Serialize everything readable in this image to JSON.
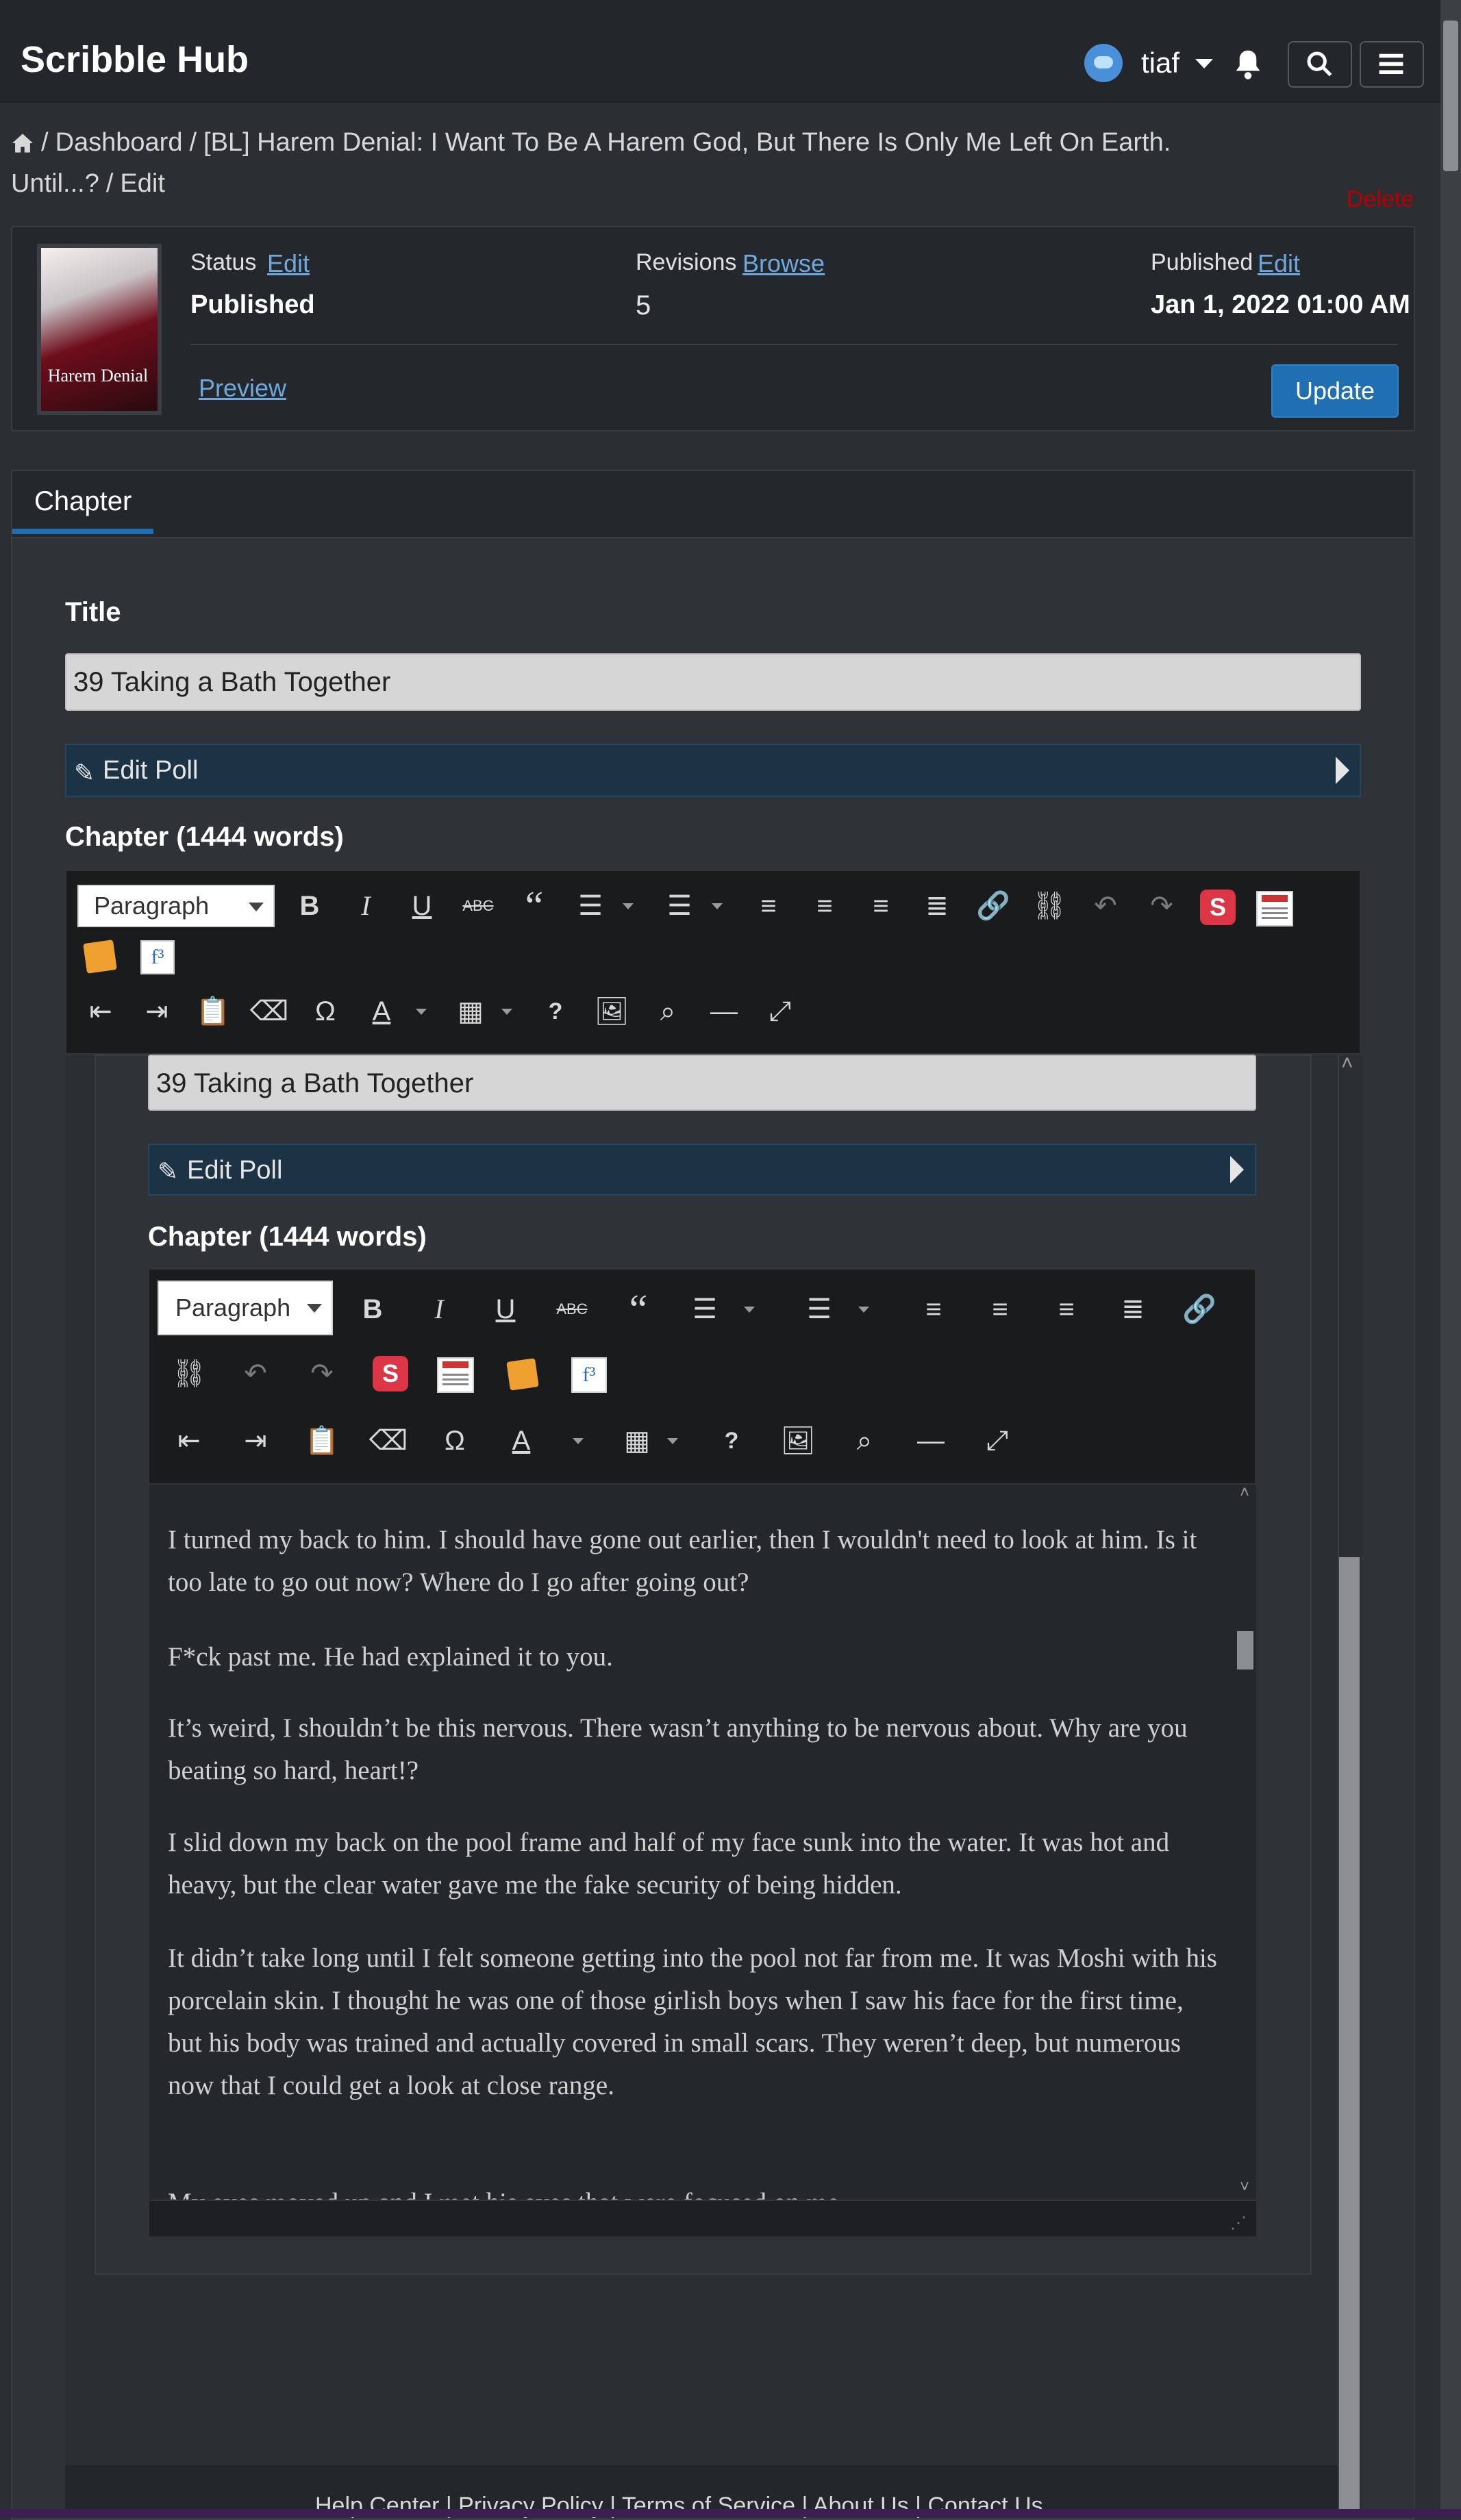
{
  "nav": {
    "brand": "Scribble Hub",
    "username": "tiaf",
    "icons": [
      "bell-icon",
      "search-icon",
      "menu-icon"
    ]
  },
  "breadcrumb": {
    "home_icon": "home-icon",
    "items": [
      "Dashboard",
      "[BL] Harem Denial: I Want To Be A Harem God, But There Is Only Me Left On Earth. Until...?",
      "Edit"
    ],
    "delete": "Delete"
  },
  "info": {
    "cover_text": "Harem Denial",
    "status_label": "Status",
    "status_edit": "Edit",
    "status_value": "Published",
    "revisions_label": "Revisions",
    "revisions_browse": "Browse",
    "revisions_value": "5",
    "published_label": "Published",
    "published_edit": "Edit",
    "published_value": "Jan 1, 2022 01:00 AM",
    "preview": "Preview",
    "update": "Update"
  },
  "tabs": {
    "chapter": "Chapter"
  },
  "form": {
    "title_label": "Title",
    "title_value": "39 Taking a Bath Together",
    "poll_label": "Edit Poll",
    "chapter_label": "Chapter (1444 words)"
  },
  "toolbar": {
    "paragraph": "Paragraph",
    "s_badge": "S",
    "f3_badge": "f³",
    "omega": "Ω",
    "font_color": "A",
    "help": "?"
  },
  "content": {
    "paragraphs": [
      "I turned my back to him. I should have gone out earlier, then I wouldn't need to look at him. Is it too late to go out now? Where do I go after going out?",
      "F*ck past me. He had explained it to you.",
      "It’s weird, I shouldn’t be this nervous. There wasn’t anything to be nervous about. Why are you beating so hard, heart!?",
      "I slid down my back on the pool frame and half of my face sunk into the water. It was hot and heavy, but the clear water gave me the fake security of being hidden.",
      "It didn’t take long until I felt someone getting into the pool not far from me. It was Moshi with his porcelain skin. I thought he was one of those girlish boys when I saw his face for the first time, but his body was trained and actually covered in small scars. They weren’t deep, but numerous now that I could get a look at close range.",
      "My eyes moved up and I met his eyes that were focused on me."
    ]
  },
  "footer": {
    "links": "Help Center | Privacy Policy | Terms of Service | About Us | Contact Us"
  },
  "colors": {
    "accent": "#1f6fb2",
    "link": "#6fa8dc",
    "delete": "#b40000",
    "badge_red": "#dc3545"
  }
}
